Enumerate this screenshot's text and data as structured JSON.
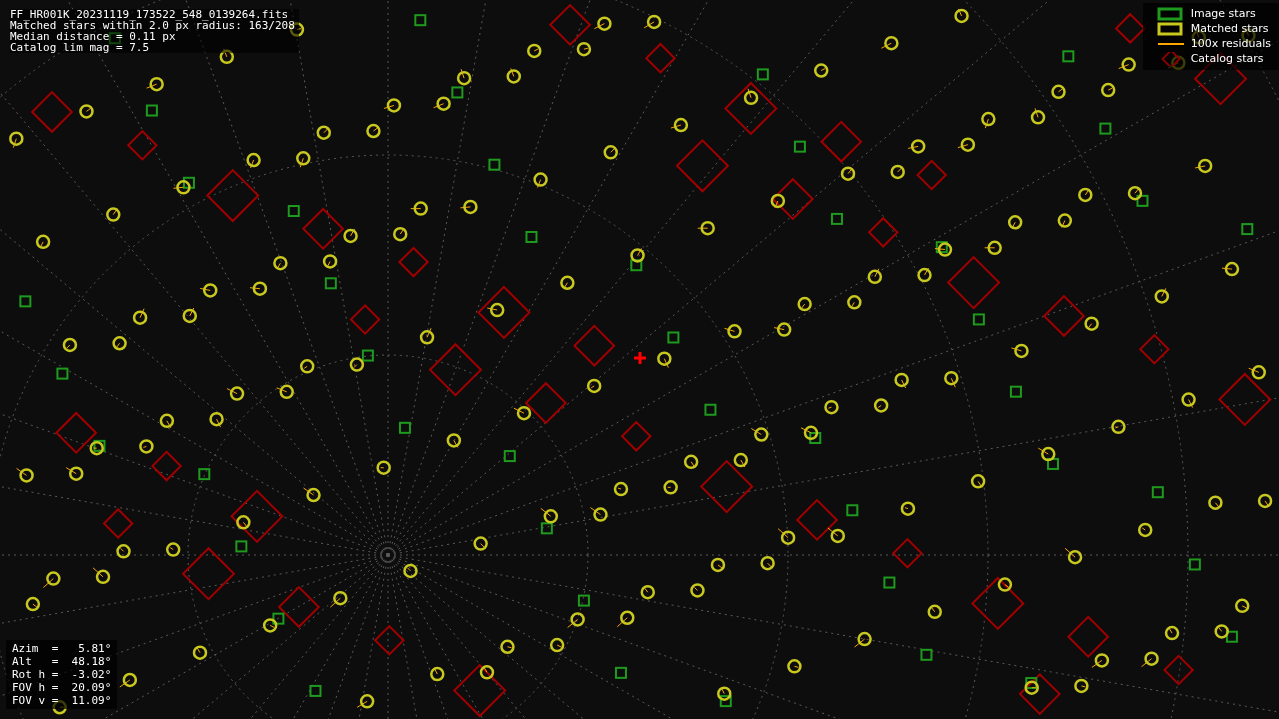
{
  "info_lines": [
    "FF_HR001K_20231119_173522_548_0139264.fits",
    "Matched stars within 2.0 px radius: 163/208",
    "Median distance = 0.11 px",
    "Catalog lim mag = 7.5"
  ],
  "legend": [
    {
      "label": "Image stars",
      "kind": "box",
      "color": "#1e9a1e"
    },
    {
      "label": "Matched stars",
      "kind": "box",
      "color": "#c8c81e"
    },
    {
      "label": "100x residuals",
      "kind": "line",
      "color": "#ffa500"
    },
    {
      "label": "Catalog stars",
      "kind": "diamond",
      "color": "#8b0000"
    }
  ],
  "pointing": [
    "Azim  =   5.81°",
    "Alt   =  48.18°",
    "Rot h =  -3.02°",
    "FOV h =  20.09°",
    "FOV v =  11.09°"
  ]
}
